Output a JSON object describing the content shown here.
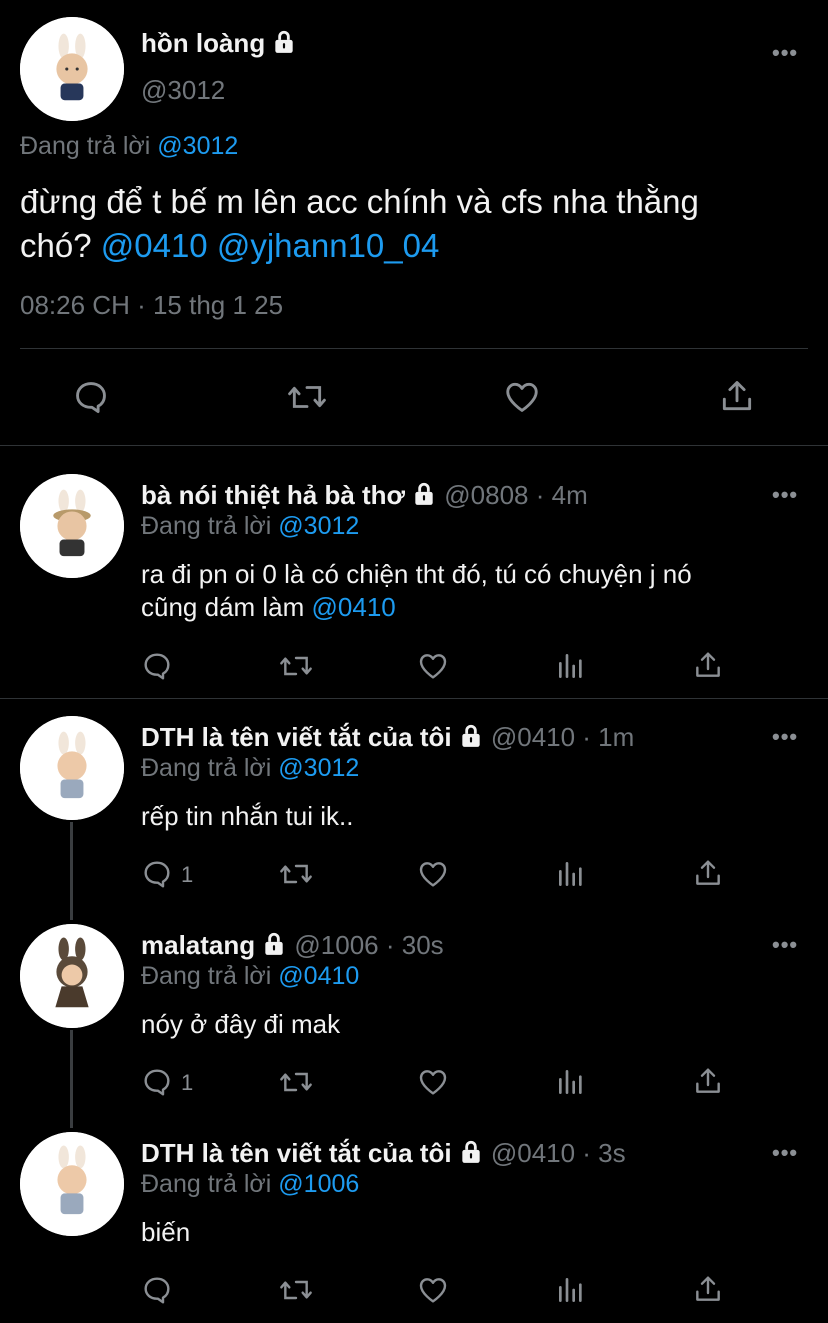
{
  "main_tweet": {
    "display_name": "hồn loàng",
    "handle": "@3012",
    "replying_prefix": "Đang trả lời",
    "replying_to": "@3012",
    "text_line1": "đừng để t bế m lên acc chính và cfs nha thằng",
    "text_line2_prefix": "chó? ",
    "mention1": "@0410",
    "mention2": "@yjhann10_04",
    "timestamp": "08:26 CH · 15 thg 1 25",
    "more_label": "•••"
  },
  "replies": [
    {
      "display_name": "bà nói thiệt hả bà thơ",
      "meta": "@0808 · 4m",
      "replying_prefix": "Đang trả lời",
      "replying_to": "@3012",
      "text_line1": "ra đi pn oi 0 là có chiện tht đó, tú có chuyện j nó",
      "text_line2": "cũng dám làm ",
      "text_mention": "@0410",
      "reply_count": "",
      "more_label": "•••"
    },
    {
      "display_name": "DTH là tên viết tắt của tôi",
      "meta": "@0410 · 1m",
      "replying_prefix": "Đang trả lời",
      "replying_to": "@3012",
      "text_line1": "rếp tin nhắn tui ik..",
      "reply_count": "1",
      "more_label": "•••"
    },
    {
      "display_name": "malatang",
      "meta": "@1006 · 30s",
      "replying_prefix": "Đang trả lời",
      "replying_to": "@0410",
      "text_line1": "nóy ở đây đi mak",
      "reply_count": "1",
      "more_label": "•••"
    },
    {
      "display_name": "DTH là tên viết tắt của tôi",
      "meta": "@0410 · 3s",
      "replying_prefix": "Đang trả lời",
      "replying_to": "@1006",
      "text_line1": "biến",
      "reply_count": "",
      "more_label": "•••"
    }
  ],
  "icons": {
    "reply": "reply-icon",
    "retweet": "retweet-icon",
    "like": "like-icon",
    "views": "views-icon",
    "share": "share-icon",
    "lock": "lock-icon"
  },
  "colors": {
    "background": "#000000",
    "text": "#f2f2f2",
    "muted": "#71767b",
    "mention": "#1d9bf0",
    "divider": "#2f3336"
  }
}
